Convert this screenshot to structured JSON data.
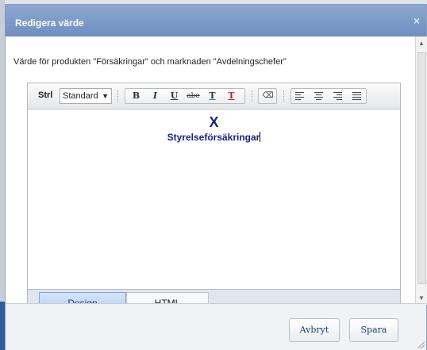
{
  "dialog": {
    "title": "Redigera värde",
    "close_glyph": "×",
    "description": "Värde för produkten \"Försäkringar\" och marknaden \"Avdelningschefer\""
  },
  "toolbar": {
    "style_label": "Strl",
    "style_select_value": "Standard",
    "style_select_arrow": "▼",
    "bold": "B",
    "italic": "I",
    "underline": "U",
    "strike": "abe",
    "font_color": "T",
    "clear_format": "T",
    "eraser": "⌫",
    "icons": [
      "bold-icon",
      "italic-icon",
      "underline-icon",
      "strikethrough-icon",
      "font-color-icon",
      "clear-format-icon",
      "eraser-icon",
      "align-left-icon",
      "align-center-icon",
      "align-right-icon",
      "justify-icon"
    ]
  },
  "editor": {
    "heading": "X",
    "text": "Styrelseförsäkringar"
  },
  "mode_tabs": {
    "design": "Design",
    "html": "HTML",
    "active": "Design"
  },
  "footer": {
    "cancel": "Avbryt",
    "save": "Spara"
  },
  "colors": {
    "titlebar": "#7f9dcb",
    "editor_text": "#1a237e",
    "active_tab": "#c4daf3"
  }
}
